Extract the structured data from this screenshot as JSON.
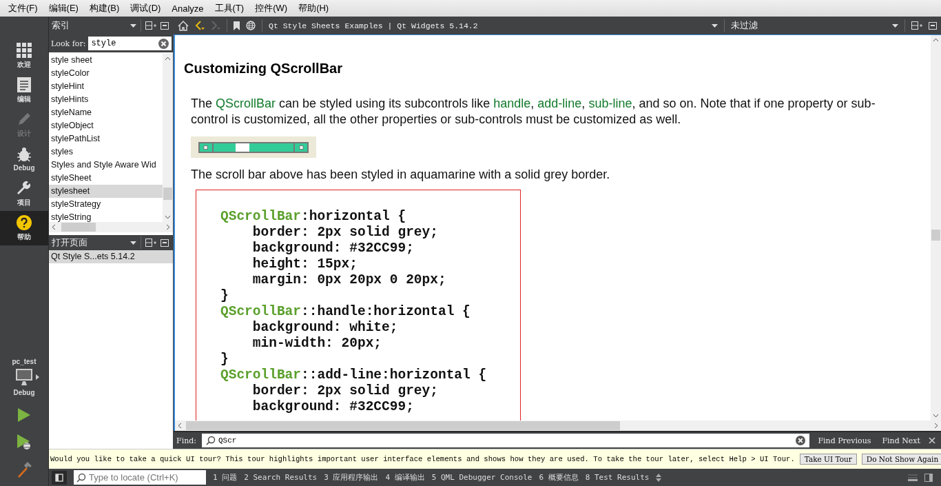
{
  "menu": [
    "文件(F)",
    "编辑(E)",
    "构建(B)",
    "调试(D)",
    "Analyze",
    "工具(T)",
    "控件(W)",
    "帮助(H)"
  ],
  "modes": [
    {
      "label": "欢迎",
      "kind": "welcome",
      "selected": false,
      "disabled": false
    },
    {
      "label": "编辑",
      "kind": "edit",
      "selected": false,
      "disabled": false
    },
    {
      "label": "设计",
      "kind": "design",
      "selected": false,
      "disabled": true
    },
    {
      "label": "Debug",
      "kind": "debug",
      "selected": false,
      "disabled": false
    },
    {
      "label": "项目",
      "kind": "project",
      "selected": false,
      "disabled": false
    },
    {
      "label": "帮助",
      "kind": "help",
      "selected": true,
      "disabled": false
    }
  ],
  "target": {
    "project": "pc_test",
    "config": "Debug"
  },
  "index_panel": {
    "title": "索引",
    "look_for_label": "Look for:",
    "search_value": "style",
    "items": [
      {
        "label": "style sheet",
        "selected": false
      },
      {
        "label": "styleColor",
        "selected": false
      },
      {
        "label": "styleHint",
        "selected": false
      },
      {
        "label": "styleHints",
        "selected": false
      },
      {
        "label": "styleName",
        "selected": false
      },
      {
        "label": "styleObject",
        "selected": false
      },
      {
        "label": "stylePathList",
        "selected": false
      },
      {
        "label": "styles",
        "selected": false
      },
      {
        "label": "Styles and Style Aware Wid",
        "selected": false
      },
      {
        "label": "styleSheet",
        "selected": false
      },
      {
        "label": "stylesheet",
        "selected": true
      },
      {
        "label": "styleStrategy",
        "selected": false
      },
      {
        "label": "styleString",
        "selected": false
      }
    ]
  },
  "open_pages": {
    "title": "打开页面",
    "items": [
      {
        "label": "Qt Style S...ets 5.14.2",
        "selected": true
      }
    ]
  },
  "toolbar": {
    "page_title": "Qt Style Sheets Examples | Qt Widgets 5.14.2",
    "filter": "未过滤"
  },
  "document": {
    "heading": "Customizing QScrollBar",
    "intro": [
      {
        "text": "The ",
        "link": false
      },
      {
        "text": "QScrollBar",
        "link": true
      },
      {
        "text": " can be styled using its subcontrols like ",
        "link": false
      },
      {
        "text": "handle",
        "link": true
      },
      {
        "text": ", ",
        "link": false
      },
      {
        "text": "add-line",
        "link": true
      },
      {
        "text": ", ",
        "link": false
      },
      {
        "text": "sub-line",
        "link": true
      },
      {
        "text": ", and so on. Note that if one property or sub-control is customized, all the other properties or sub-controls must be customized as well.",
        "link": false
      }
    ],
    "caption": "The scroll bar above has been styled in aquamarine with a solid grey border.",
    "code": [
      {
        "highlight": "QScrollBar",
        "rest": ":horizontal {"
      },
      {
        "rest": "    border: 2px solid grey;"
      },
      {
        "rest": "    background: #32CC99;"
      },
      {
        "rest": "    height: 15px;"
      },
      {
        "rest": "    margin: 0px 20px 0 20px;"
      },
      {
        "rest": "}"
      },
      {
        "highlight": "QScrollBar",
        "rest": "::handle:horizontal {"
      },
      {
        "rest": "    background: white;"
      },
      {
        "rest": "    min-width: 20px;"
      },
      {
        "rest": "}"
      },
      {
        "highlight": "QScrollBar",
        "rest": "::add-line:horizontal {"
      },
      {
        "rest": "    border: 2px solid grey;"
      },
      {
        "rest": "    background: #32CC99;"
      }
    ]
  },
  "find": {
    "label": "Find:",
    "value": "QScr",
    "previous": "Find Previous",
    "next": "Find Next"
  },
  "tour": {
    "message": "Would you like to take a quick UI tour? This tour highlights important user interface elements and shows how they are used. To take the tour later, select Help > UI Tour.",
    "buttons": [
      "Take UI Tour",
      "Do Not Show Again"
    ]
  },
  "status": {
    "locate_placeholder": "Type to locate (Ctrl+K)",
    "panes": [
      "1 问题",
      "2 Search Results",
      "3 应用程序输出",
      "4 编译输出",
      "5 QML Debugger Console",
      "6 概要信息",
      "8 Test Results"
    ]
  }
}
